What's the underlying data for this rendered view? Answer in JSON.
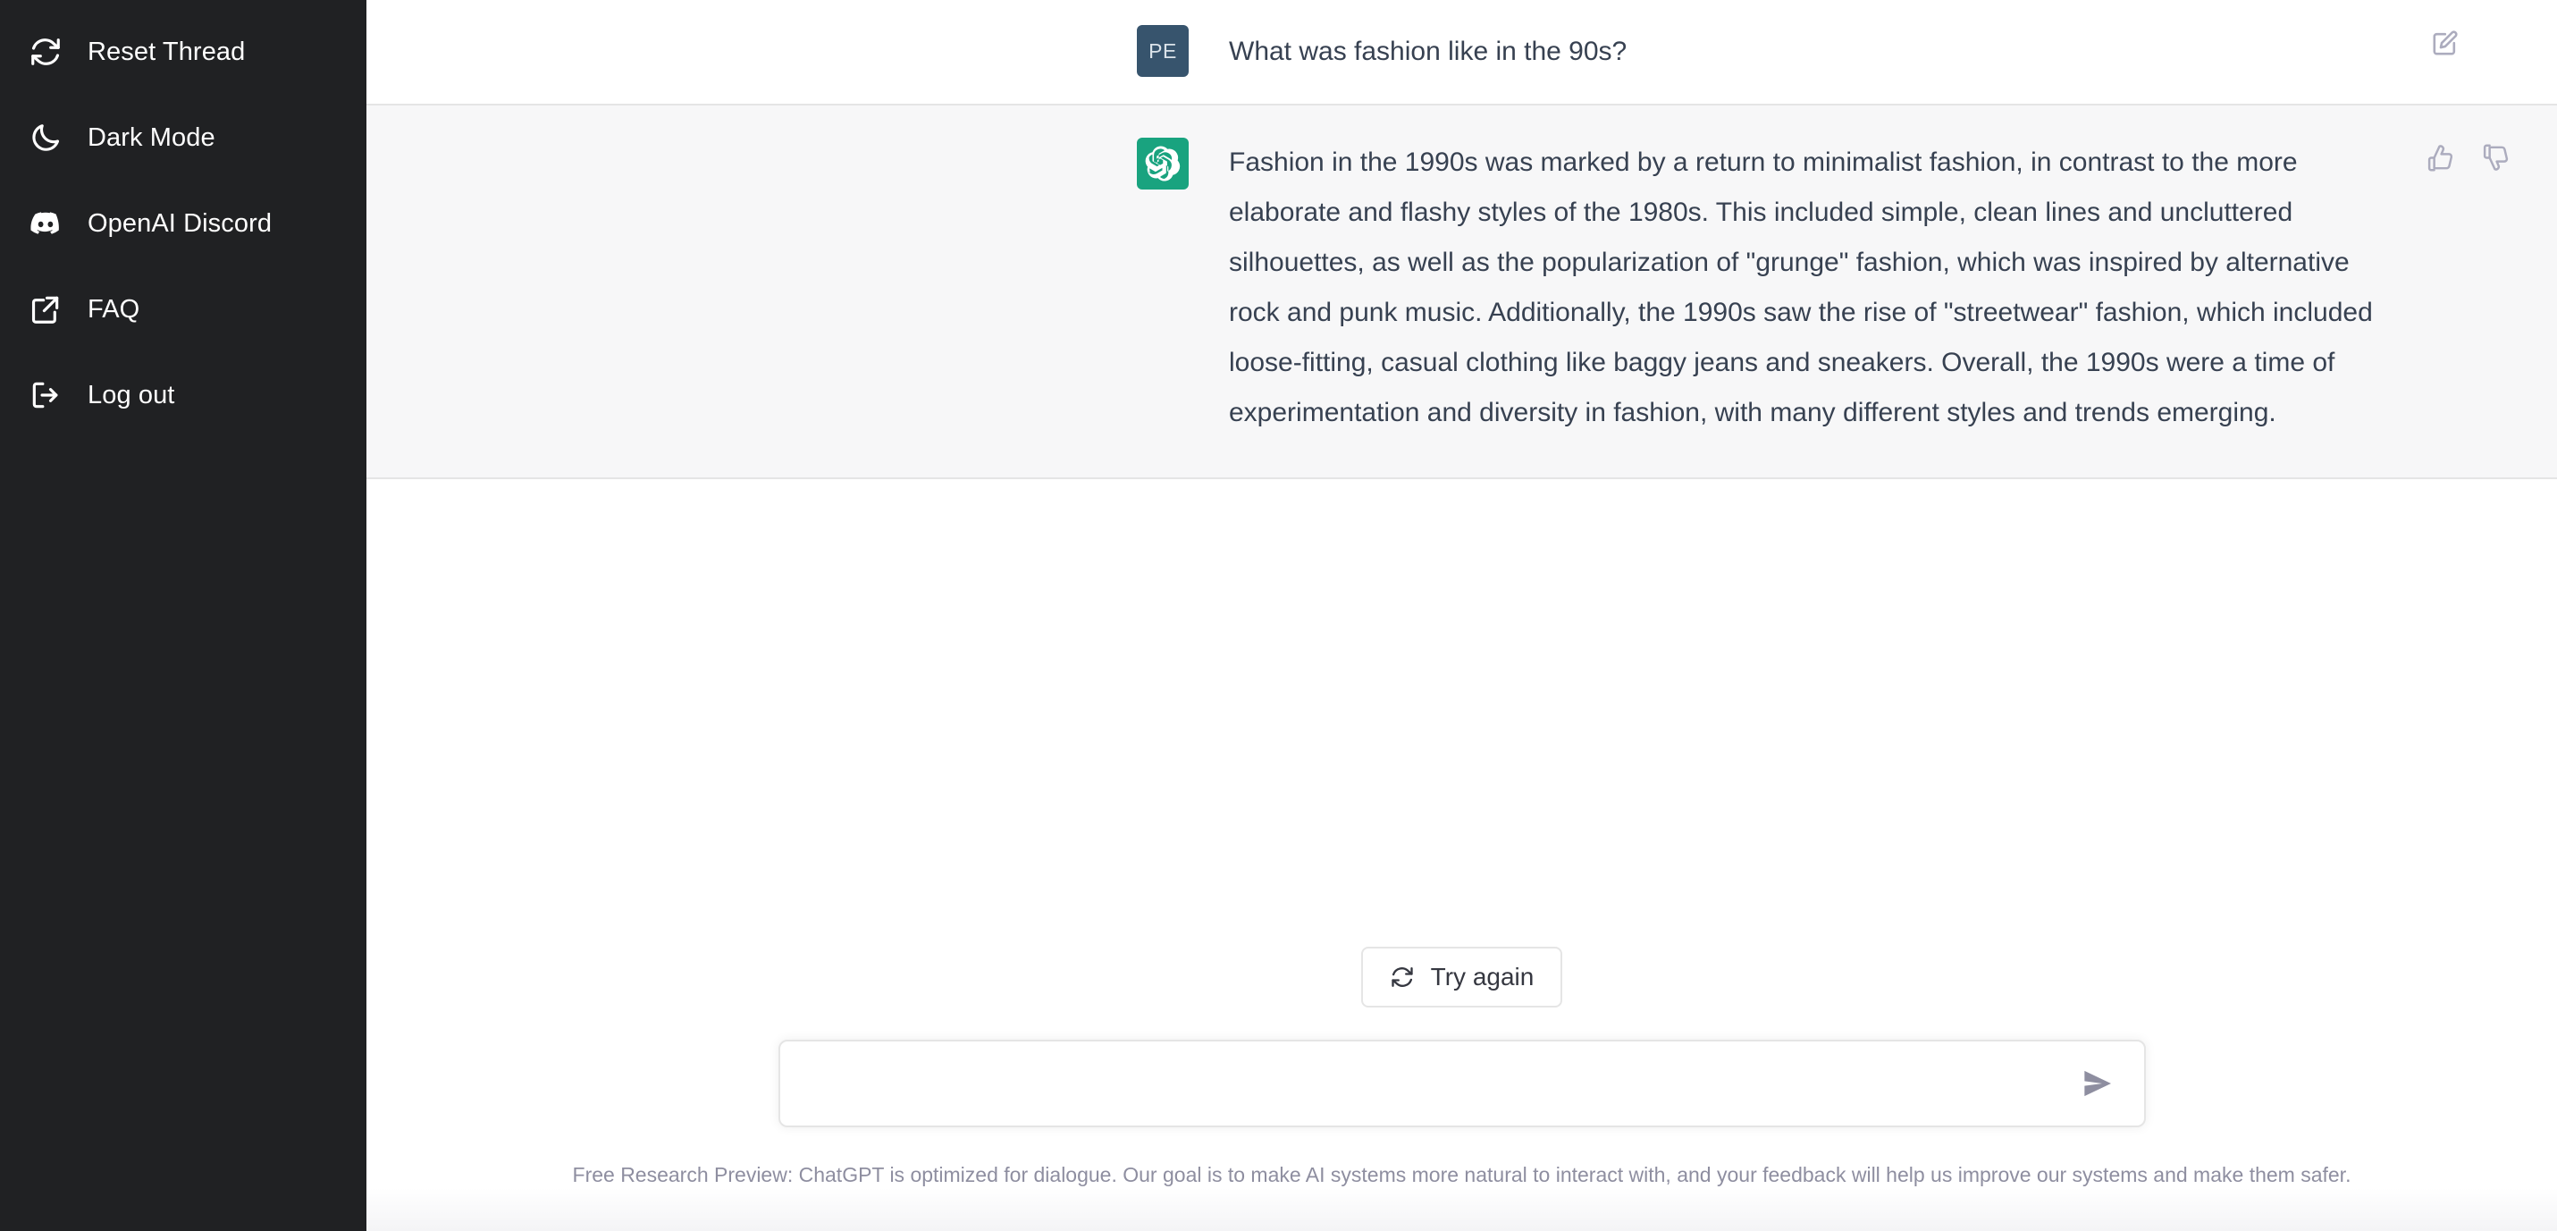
{
  "sidebar": {
    "items": [
      {
        "label": "Reset Thread",
        "icon": "reset-icon"
      },
      {
        "label": "Dark Mode",
        "icon": "moon-icon"
      },
      {
        "label": "OpenAI Discord",
        "icon": "discord-icon"
      },
      {
        "label": "FAQ",
        "icon": "external-link-icon"
      },
      {
        "label": "Log out",
        "icon": "logout-icon"
      }
    ],
    "background_color": "#202123",
    "text_color": "#ffffff"
  },
  "conversation": {
    "messages": [
      {
        "role": "user",
        "avatar_initials": "PE",
        "avatar_color": "#37546d",
        "text": "What was fashion like in the 90s?",
        "actions": [
          {
            "name": "edit-icon",
            "label": "Edit message"
          }
        ]
      },
      {
        "role": "assistant",
        "avatar_color": "#19a37f",
        "avatar_icon": "openai-logo-icon",
        "text": "Fashion in the 1990s was marked by a return to minimalist fashion, in contrast to the more elaborate and flashy styles of the 1980s. This included simple, clean lines and uncluttered silhouettes, as well as the popularization of \"grunge\" fashion, which was inspired by alternative rock and punk music. Additionally, the 1990s saw the rise of \"streetwear\" fashion, which included loose-fitting, casual clothing like baggy jeans and sneakers. Overall, the 1990s were a time of experimentation and diversity in fashion, with many different styles and trends emerging.",
        "actions": [
          {
            "name": "thumbs-up-icon",
            "label": "Good response"
          },
          {
            "name": "thumbs-down-icon",
            "label": "Bad response"
          }
        ]
      }
    ]
  },
  "controls": {
    "try_again_label": "Try again",
    "try_again_icon": "reset-icon",
    "send_icon": "send-icon"
  },
  "composer": {
    "value": "",
    "placeholder": ""
  },
  "footer": {
    "note": "Free Research Preview: ChatGPT is optimized for dialogue. Our goal is to make AI systems more natural to interact with, and your feedback will help us improve our systems and make them safer."
  },
  "theme": {
    "user_message_bg": "#ffffff",
    "assistant_message_bg": "#f7f7f8",
    "accent_green": "#19a37f",
    "divider": "#e5e5e5",
    "body_text": "#374151",
    "muted_text": "#8e8ea0"
  }
}
